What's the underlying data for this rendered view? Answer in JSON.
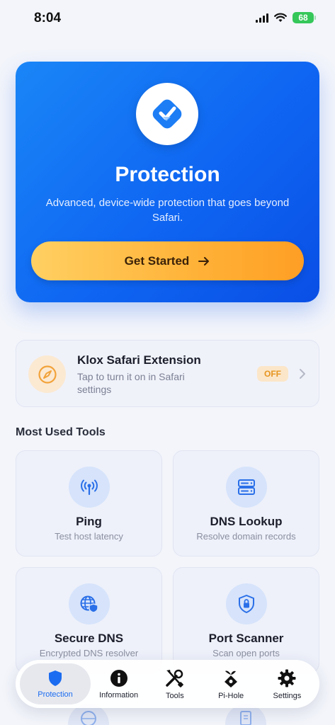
{
  "status_bar": {
    "time": "8:04",
    "battery": "68"
  },
  "hero": {
    "title": "Protection",
    "subtitle": "Advanced, device-wide protection that goes beyond Safari.",
    "cta_label": "Get Started",
    "colors": {
      "gradient_start": "#1a86f7",
      "gradient_end": "#0a4fe6",
      "cta": "#ffb238"
    }
  },
  "extension": {
    "title": "Klox Safari Extension",
    "description": "Tap to turn it on in Safari settings",
    "status": "OFF",
    "icon": "compass-icon"
  },
  "section": {
    "most_used_title": "Most Used Tools"
  },
  "tools": [
    {
      "name": "Ping",
      "description": "Test host latency",
      "icon": "antenna-icon"
    },
    {
      "name": "DNS Lookup",
      "description": "Resolve domain records",
      "icon": "server-icon"
    },
    {
      "name": "Secure DNS",
      "description": "Encrypted DNS resolver",
      "icon": "globe-shield-icon"
    },
    {
      "name": "Port Scanner",
      "description": "Scan open ports",
      "icon": "shield-lock-icon"
    }
  ],
  "tab_bar": {
    "active_index": 0,
    "items": [
      {
        "label": "Protection",
        "icon": "shield-icon"
      },
      {
        "label": "Information",
        "icon": "info-icon"
      },
      {
        "label": "Tools",
        "icon": "tools-icon"
      },
      {
        "label": "Pi-Hole",
        "icon": "pihole-icon"
      },
      {
        "label": "Settings",
        "icon": "gear-icon"
      }
    ]
  },
  "colors": {
    "accent": "#1b6cf0",
    "background": "#f3f5fb",
    "warning": "#e69520"
  }
}
